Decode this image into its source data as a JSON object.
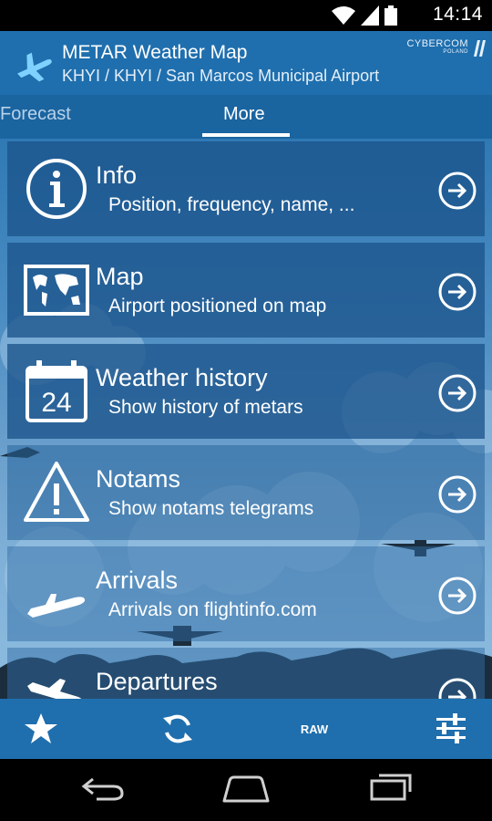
{
  "status_bar": {
    "time": "14:14"
  },
  "header": {
    "title": "METAR Weather Map",
    "subtitle": "KHYI / KHYI / San Marcos Municipal Airport",
    "brand": "CYBERCOM",
    "brand_sub": "POLAND"
  },
  "tabs": [
    {
      "label": "Forecast",
      "active": false
    },
    {
      "label": "More",
      "active": true
    }
  ],
  "menu": [
    {
      "title": "Info",
      "subtitle": "Position, frequency, name, ...",
      "icon": "info-icon"
    },
    {
      "title": "Map",
      "subtitle": "Airport positioned on map",
      "icon": "world-map-icon"
    },
    {
      "title": "Weather history",
      "subtitle": "Show history of metars",
      "icon": "calendar-icon",
      "calendar_day": "24"
    },
    {
      "title": "Notams",
      "subtitle": "Show notams telegrams",
      "icon": "warning-icon"
    },
    {
      "title": "Arrivals",
      "subtitle": "Arrivals on flightinfo.com",
      "icon": "plane-landing-icon"
    },
    {
      "title": "Departures",
      "subtitle": "",
      "icon": "plane-takeoff-icon"
    }
  ],
  "toolbar": {
    "favorite_icon": "star-icon",
    "refresh_icon": "refresh-icon",
    "raw_label": "RAW",
    "settings_icon": "sliders-icon"
  },
  "colors": {
    "primary": "#1f6fae",
    "tab_bar": "#1a64a0",
    "item_bg": "#1c548c"
  }
}
